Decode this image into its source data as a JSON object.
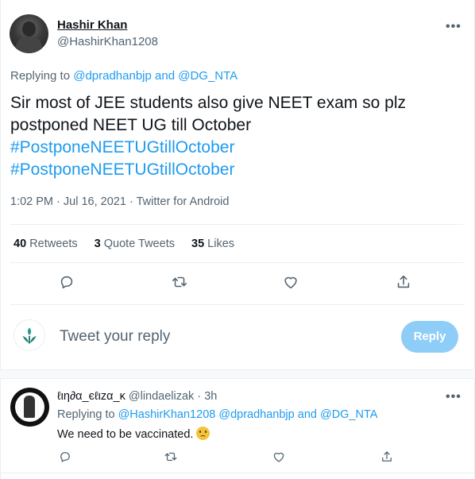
{
  "tweet": {
    "author_name": "Hashir Khan",
    "author_handle": "@HashirKhan1208",
    "more_label": "•••",
    "replying_prefix": "Replying to",
    "reply_to_1": "@dpradhanbjp",
    "reply_to_and": "and",
    "reply_to_2": "@DG_NTA",
    "text_line1": "Sir most of JEE students also give NEET exam so plz",
    "text_line2": "postponed NEET UG till October",
    "hashtag1": "#PostponeNEETUGtillOctober",
    "hashtag2": "#PostponeNEETUGtillOctober",
    "time": "1:02 PM",
    "date": "Jul 16, 2021",
    "source": "Twitter for Android",
    "dot": "·"
  },
  "stats": {
    "retweets_count": "40",
    "retweets_label": "Retweets",
    "quotes_count": "3",
    "quotes_label": "Quote Tweets",
    "likes_count": "35",
    "likes_label": "Likes"
  },
  "compose": {
    "placeholder": "Tweet your reply",
    "reply_button": "Reply"
  },
  "reply": {
    "display_name": "ℓιη∂α_єℓιzα_κ",
    "handle": "@lindaelizak",
    "dot": "·",
    "age": "3h",
    "more_label": "•••",
    "replying_prefix": "Replying to",
    "to_1": "@HashirKhan1208",
    "to_2": "@dpradhanbjp",
    "and": "and",
    "to_3": "@DG_NTA",
    "text": "We need to be vaccinated."
  },
  "icons": {
    "reply": "reply-icon",
    "retweet": "retweet-icon",
    "like": "heart-icon",
    "share": "share-icon",
    "brand": "leaf-logo-icon"
  },
  "colors": {
    "accent": "#1d9bf0",
    "reply_button_disabled": "#8ecdf8",
    "muted_text": "#536471"
  }
}
